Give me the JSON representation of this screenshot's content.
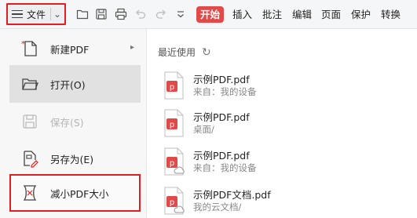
{
  "toolbar": {
    "file_label": "文件",
    "icons": [
      "open-folder-icon",
      "save-icon",
      "print-icon",
      "undo-icon",
      "redo-icon",
      "more-dropdown-icon"
    ],
    "tabs": [
      {
        "label": "开始",
        "active": true
      },
      {
        "label": "插入",
        "active": false
      },
      {
        "label": "批注",
        "active": false
      },
      {
        "label": "编辑",
        "active": false
      },
      {
        "label": "页面",
        "active": false
      },
      {
        "label": "保护",
        "active": false
      },
      {
        "label": "转换",
        "active": false
      }
    ],
    "active_tab_color": "#e24a4a",
    "highlight_color": "#e02020"
  },
  "menu": {
    "items": [
      {
        "label": "新建PDF",
        "icon": "new-pdf-icon",
        "submenu": true
      },
      {
        "label": "打开(O)",
        "icon": "open-folder-icon",
        "hover": true
      },
      {
        "label": "保存(S)",
        "icon": "save-icon",
        "disabled": true
      },
      {
        "label": "另存为(E)",
        "icon": "save-as-icon"
      },
      {
        "label": "减小PDF大小",
        "icon": "compress-pdf-icon",
        "highlighted": true
      }
    ]
  },
  "recent": {
    "title": "最近使用",
    "refresh_icon": "refresh-icon",
    "files": [
      {
        "name": "示例PDF.pdf",
        "location": "来自：我的设备",
        "cloud": false
      },
      {
        "name": "示例PDF.pdf",
        "location": "桌面/",
        "cloud": false
      },
      {
        "name": "示例PDF.pdf",
        "location": "来自：我的设备",
        "cloud": true
      },
      {
        "name": "示例PDF文档.pdf",
        "location": "我的云文档/",
        "cloud": true
      }
    ]
  }
}
